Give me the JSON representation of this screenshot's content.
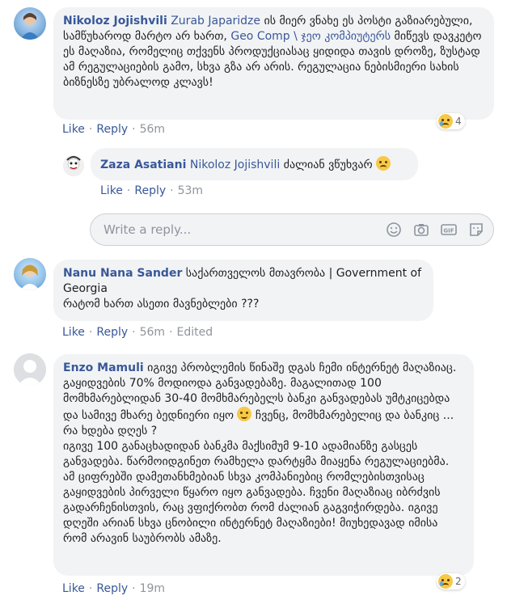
{
  "comments": [
    {
      "author": "Nikoloz Jojishvili",
      "mention": "Zurab Japaridze",
      "text_a": " ის მიერ ვნახე ეს პოსტი გაზიარებული, სამწუხაროდ მარტო არ ხართ, ",
      "mention2": "Geo Comp \\ ჯეო კომპიუტერს",
      "text_b": " მიწევს დავკეტო ეს მაღაზია, რომელიც თქვენს პროდუქციასაც ყიდიდა თავის დროზე, ზუსტად ამ რეგულაციების გამო, სხვა გზა არ არის. რეგულაცია ნებისმიერი სახის ბიზნესზე უბრალოდ კლავს!",
      "like": "Like",
      "reply": "Reply",
      "time": "56m",
      "reaction_count": "4"
    },
    {
      "author": "Zaza Asatiani",
      "mention": "Nikoloz Jojishvili",
      "text_a": " ძალიან ვწუხვარ ",
      "like": "Like",
      "reply": "Reply",
      "time": "53m"
    },
    {
      "author": "Nanu Nana Sander",
      "text_a": " საქართველოს მთავრობა | Government of Georgia",
      "text_b": "რატომ ხართ ასეთი მავნებლები ???",
      "like": "Like",
      "reply": "Reply",
      "time": "56m",
      "edited": "Edited"
    },
    {
      "author": "Enzo Mamuli",
      "text_a": " იგივე პრობლემის წინაშე დგას ჩემი ინტერნეტ მაღაზიაც. გაყიდვების 70% მოდიოდა განვადებაზე. მაგალითად 100 მომხმარებლიდან 30-40 მომხმარებელს ბანკი განვადებას უმტკიცებდა და სამივე მხარე ბედნიერი იყო ",
      "text_b": " ჩვენც, მომხმარებელიც და ბანკიც ... რა ხდება დღეს ?",
      "text_c": "იგივე 100 განაცხადიდან ბანკმა მაქსიმუმ 9-10 ადამიანზე გასცეს განვადება. წარმოიდგინეთ რამხელა დარტყმა მიაყენა რეგულაციებმა. ამ ციფრებში დამეთანხმებიან სხვა კომპანიებიც რომლებისთვისაც გაყიდვების პირველი წყარო იყო განვადება. ჩვენი მაღაზიაც იბრძვის გადარჩენისთვის, რაც ვფიქრობთ რომ ძალიან გაგვიჭირდება. იგივე დღეში არიან სხვა ცნობილი ინტერნეტ მაღაზიები! მიუხედავად იმისა რომ არავინ საუბრობს ამაზე.",
      "like": "Like",
      "reply": "Reply",
      "time": "19m",
      "reaction_count": "2"
    }
  ],
  "reply_box": {
    "placeholder": "Write a reply..."
  },
  "separator": "·",
  "icons": [
    "emoji-icon",
    "camera-icon",
    "gif-icon",
    "sticker-icon"
  ]
}
